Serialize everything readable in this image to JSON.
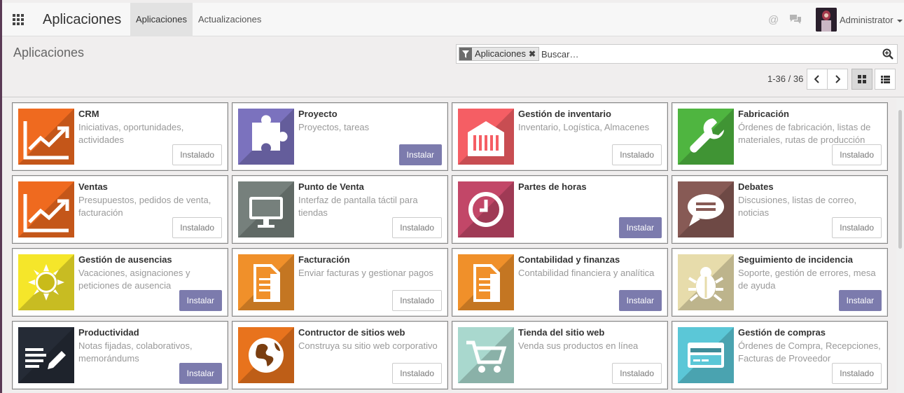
{
  "colors": {
    "install_button": "#7c7bad",
    "topbar": "#f7f7f7",
    "background": "#f0eeee"
  },
  "navbar": {
    "brand": "Aplicaciones",
    "tabs": [
      {
        "label": "Aplicaciones",
        "active": true
      },
      {
        "label": "Actualizaciones",
        "active": false
      }
    ],
    "icons": [
      "apps-grid-icon",
      "at-sign-icon",
      "chat-icon"
    ],
    "user": "Administrator"
  },
  "control_panel": {
    "title": "Aplicaciones",
    "search": {
      "facet": "Aplicaciones",
      "facet_remove": "✖",
      "placeholder": "Buscar…"
    },
    "pager": "1-36 / 36",
    "view": "kanban"
  },
  "apps": [
    {
      "name": "CRM",
      "desc": "Iniciativas, oportunidades, actividades",
      "status": "installed",
      "button": "Instalado",
      "color": "#ef6a1f",
      "icon": "chart-up-icon"
    },
    {
      "name": "Proyecto",
      "desc": "Proyectos, tareas",
      "status": "install",
      "button": "Instalar",
      "color": "#7b72be",
      "icon": "puzzle-icon"
    },
    {
      "name": "Gestión de inventario",
      "desc": "Inventario, Logística, Almacenes",
      "status": "installed",
      "button": "Instalado",
      "color": "#f55e64",
      "icon": "warehouse-icon"
    },
    {
      "name": "Fabricación",
      "desc": "Órdenes de fabricación, listas de materiales, rutas de producción",
      "status": "installed",
      "button": "Instalado",
      "color": "#4fb540",
      "icon": "wrench-icon"
    },
    {
      "name": "Ventas",
      "desc": "Presupuestos, pedidos de venta, facturación",
      "status": "installed",
      "button": "Instalado",
      "color": "#ef6a1f",
      "icon": "chart-up-icon"
    },
    {
      "name": "Punto de Venta",
      "desc": "Interfaz de pantalla táctil para tiendas",
      "status": "installed",
      "button": "Instalado",
      "color": "#76807c",
      "icon": "monitor-icon"
    },
    {
      "name": "Partes de horas",
      "desc": "",
      "status": "install",
      "button": "Instalar",
      "color": "#c24768",
      "icon": "clock-icon"
    },
    {
      "name": "Debates",
      "desc": "Discusiones, listas de correo, noticias",
      "status": "installed",
      "button": "Instalado",
      "color": "#875a55",
      "icon": "speech-bubble-icon"
    },
    {
      "name": "Gestión de ausencias",
      "desc": "Vacaciones, asignaciones y peticiones de ausencia",
      "status": "install",
      "button": "Instalar",
      "color": "#f5e62a",
      "icon": "sun-icon"
    },
    {
      "name": "Facturación",
      "desc": "Enviar facturas y gestionar pagos",
      "status": "installed",
      "button": "Instalado",
      "color": "#f0902a",
      "icon": "document-icon"
    },
    {
      "name": "Contabilidad y finanzas",
      "desc": "Contabilidad financiera y analítica",
      "status": "install",
      "button": "Instalar",
      "color": "#f0902a",
      "icon": "document-icon"
    },
    {
      "name": "Seguimiento de incidencia",
      "desc": "Soporte, gestión de errores, mesa de ayuda",
      "status": "install",
      "button": "Instalar",
      "color": "#e7dcab",
      "icon": "bug-icon"
    },
    {
      "name": "Productividad",
      "desc": "Notas fijadas, colaborativos, memorándums",
      "status": "install",
      "button": "Instalar",
      "color": "#252b36",
      "icon": "note-pencil-icon"
    },
    {
      "name": "Contructor de sitios web",
      "desc": "Construya su sitio web corporativo",
      "status": "installed",
      "button": "Instalado",
      "color": "#e8731d",
      "icon": "globe-icon"
    },
    {
      "name": "Tienda del sitio web",
      "desc": "Venda sus productos en línea",
      "status": "installed",
      "button": "Instalado",
      "color": "#a9d8ce",
      "icon": "cart-icon"
    },
    {
      "name": "Gestión de compras",
      "desc": "Órdenes de Compra, Recepciones, Facturas de Proveedor",
      "status": "installed",
      "button": "Instalado",
      "color": "#5bc7d7",
      "icon": "credit-card-icon"
    }
  ]
}
